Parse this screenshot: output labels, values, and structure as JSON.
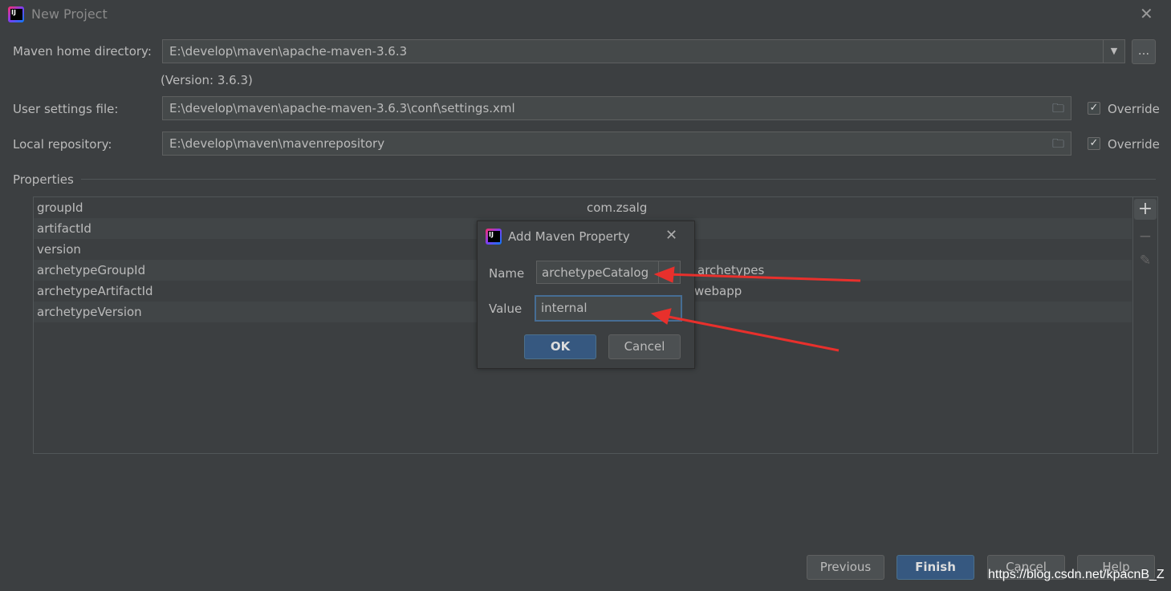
{
  "window": {
    "title": "New Project",
    "close_icon": "close-icon"
  },
  "maven_home": {
    "label": "Maven home directory:",
    "value": "E:\\develop\\maven\\apache-maven-3.6.3",
    "browse": "...",
    "version": "(Version: 3.6.3)"
  },
  "user_settings": {
    "label": "User settings file:",
    "value": "E:\\develop\\maven\\apache-maven-3.6.3\\conf\\settings.xml",
    "override": "Override",
    "override_checked": true
  },
  "local_repo": {
    "label": "Local repository:",
    "value": "E:\\develop\\maven\\mavenrepository",
    "override": "Override",
    "override_checked": true
  },
  "properties": {
    "title": "Properties",
    "rows": [
      {
        "key": "groupId",
        "value": "com.zsalg"
      },
      {
        "key": "artifactId",
        "value": ""
      },
      {
        "key": "version",
        "value": ""
      },
      {
        "key": "archetypeGroupId",
        "value": "archetypes"
      },
      {
        "key": "archetypeArtifactId",
        "value": "webapp"
      },
      {
        "key": "archetypeVersion",
        "value": ""
      }
    ]
  },
  "dialog": {
    "title": "Add Maven Property",
    "name_label": "Name",
    "name_value": "archetypeCatalog",
    "value_label": "Value",
    "value_value": "internal",
    "ok": "OK",
    "cancel": "Cancel"
  },
  "footer": {
    "previous": "Previous",
    "finish": "Finish",
    "cancel": "Cancel",
    "help": "Help"
  },
  "watermark": "https://blog.csdn.net/kpacnB_Z",
  "colors": {
    "background": "#3c3f41",
    "primary_button": "#365880",
    "arrow": "#e8302c"
  }
}
